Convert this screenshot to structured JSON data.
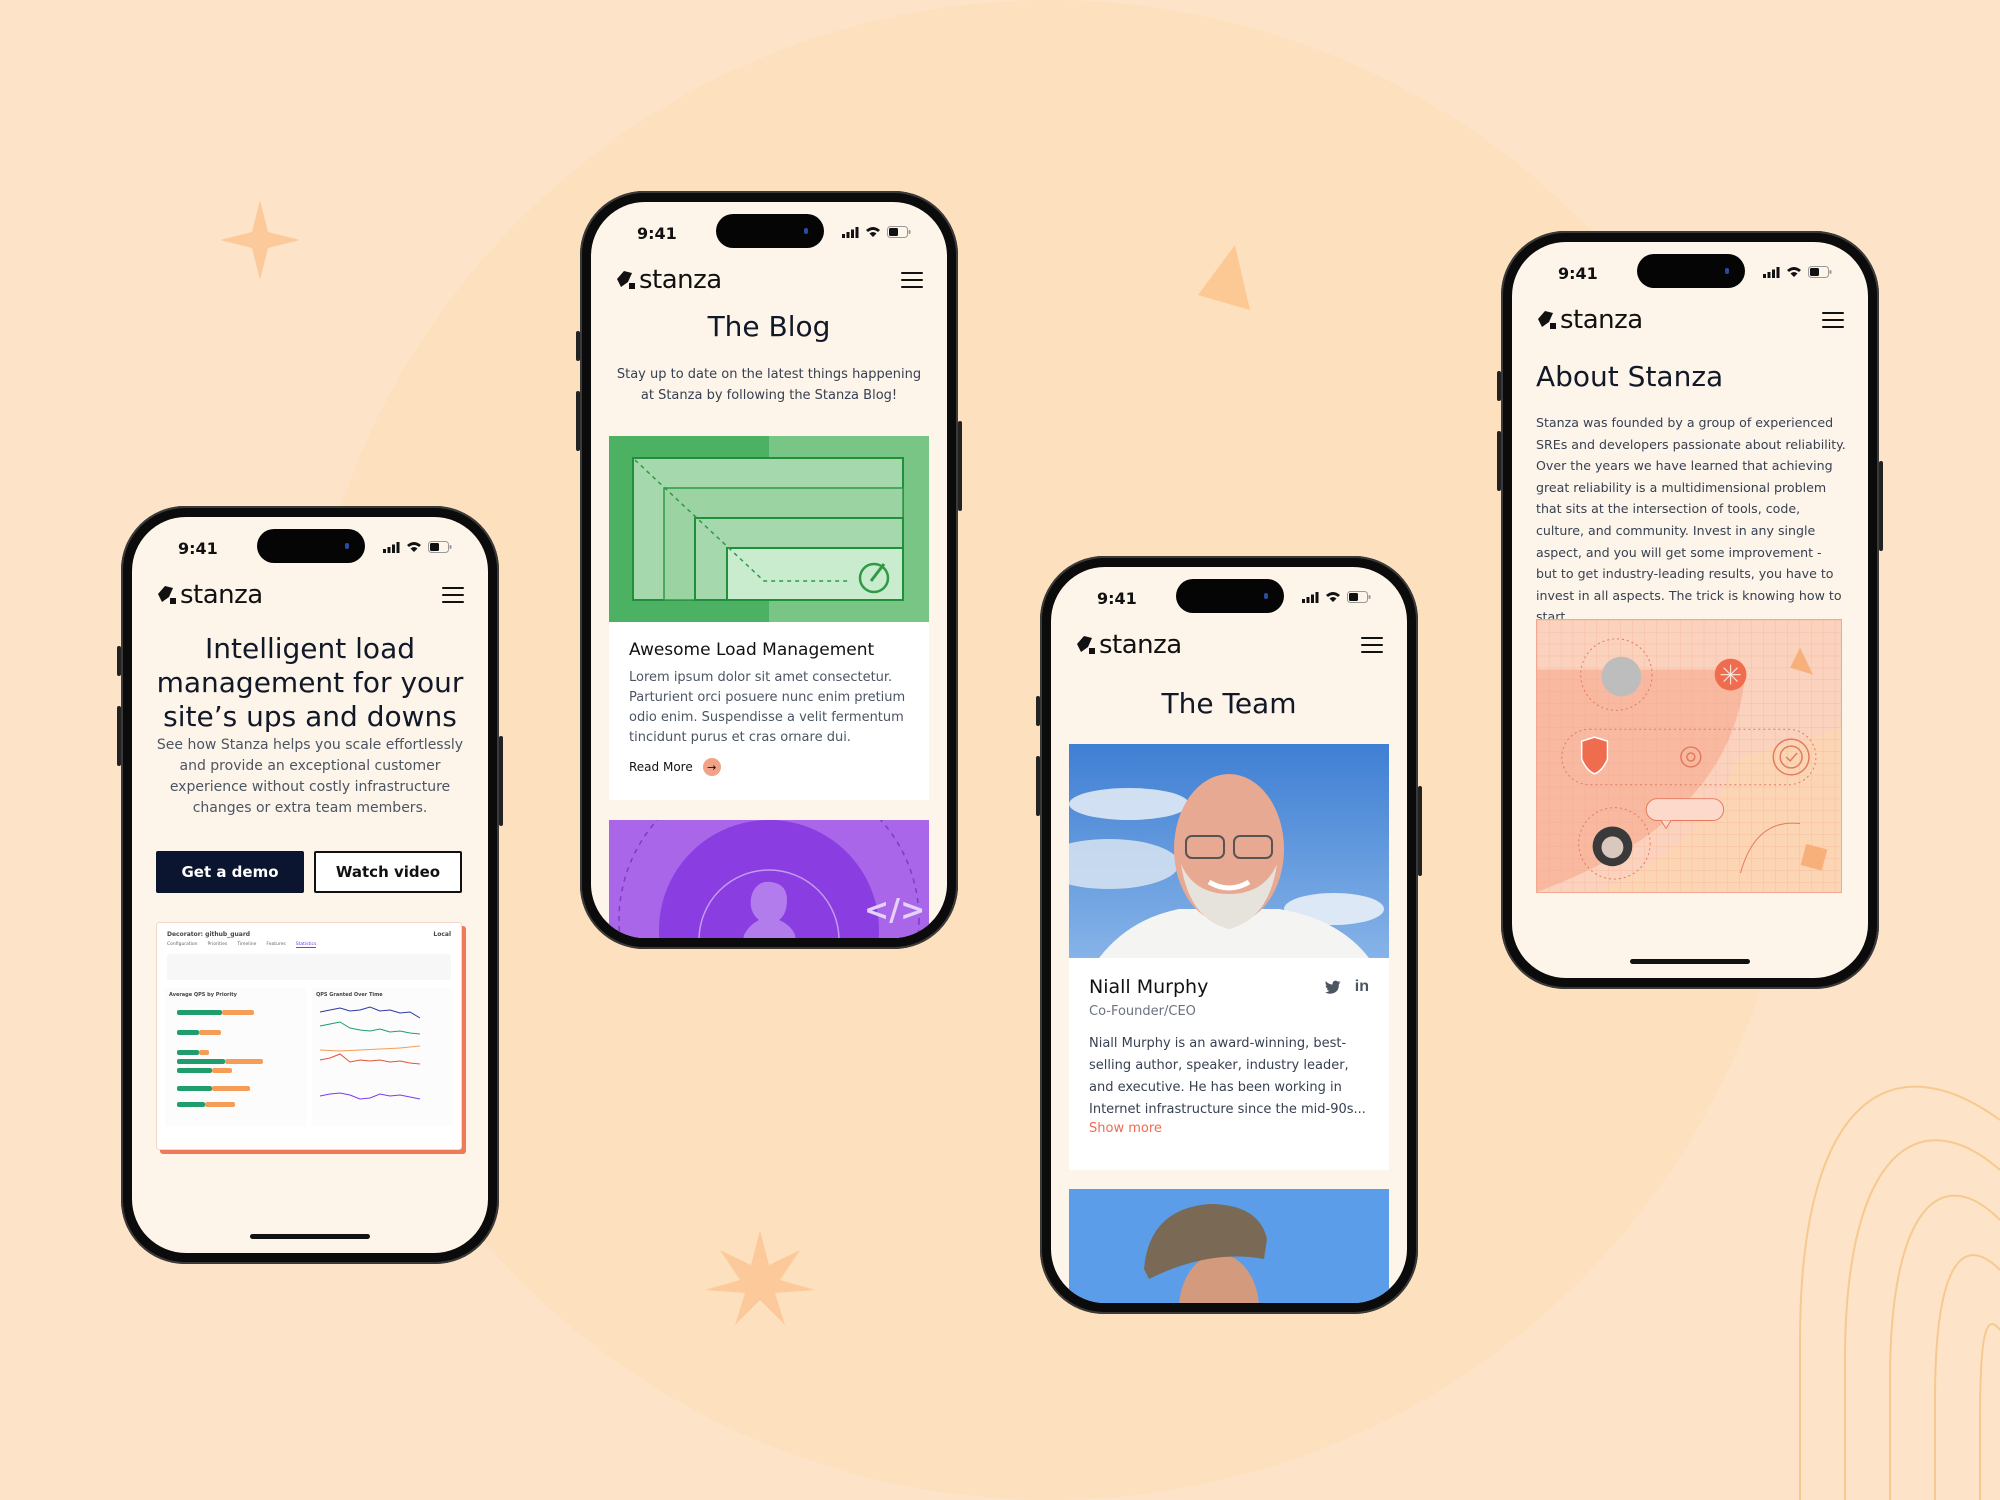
{
  "brand": {
    "name": "stanza",
    "accent": "#ef6c4f",
    "dark": "#0b1530",
    "screen_bg": "#fdf4ea",
    "page_bg": "#fde4c8"
  },
  "status_bar": {
    "time": "9:41"
  },
  "phones": {
    "home": {
      "headline": "Intelligent load management for your site’s ups and downs",
      "subtext": "See how Stanza helps you scale effortlessly and provide an exceptional customer experience without costly infrastructure changes or extra team members.",
      "primary_button": "Get a demo",
      "secondary_button": "Watch video",
      "dashboard_preview": {
        "title": "Decorator: github_guard",
        "environment": "Local",
        "tabs": [
          "Configuration",
          "Priorities",
          "Timeline",
          "Features",
          "Statistics"
        ],
        "chart_left_title": "Average QPS by Priority",
        "chart_right_title": "QPS Granted Over Time"
      }
    },
    "blog": {
      "title": "The Blog",
      "subtitle": "Stay up to date on the latest things happening at Stanza by following the Stanza Blog!",
      "post": {
        "title": "Awesome Load Management",
        "excerpt": "Lorem ipsum dolor sit amet consectetur. Parturient orci posuere nunc enim pretium odio enim. Suspendisse a velit fermentum tincidunt purus et cras ornare dui.",
        "read_more": "Read More"
      }
    },
    "team": {
      "title": "The Team",
      "member": {
        "name": "Niall Murphy",
        "role": "Co-Founder/CEO",
        "bio": "Niall Murphy is an award-winning, best-selling author, speaker, industry leader, and executive. He has been working in Internet infrastructure since the mid-90s...",
        "show_more": "Show more",
        "social": [
          "twitter",
          "linkedin"
        ]
      }
    },
    "about": {
      "title": "About Stanza",
      "body": "Stanza was founded by a group of experienced SREs and developers passionate about reliability. Over the years we have learned that achieving great reliability is a multidimensional problem that sits at the intersection of tools, code, culture, and community. Invest in any single aspect, and you will get some improvement - but to get industry-leading results, you have to invest in all aspects. The trick is knowing how to start."
    }
  }
}
